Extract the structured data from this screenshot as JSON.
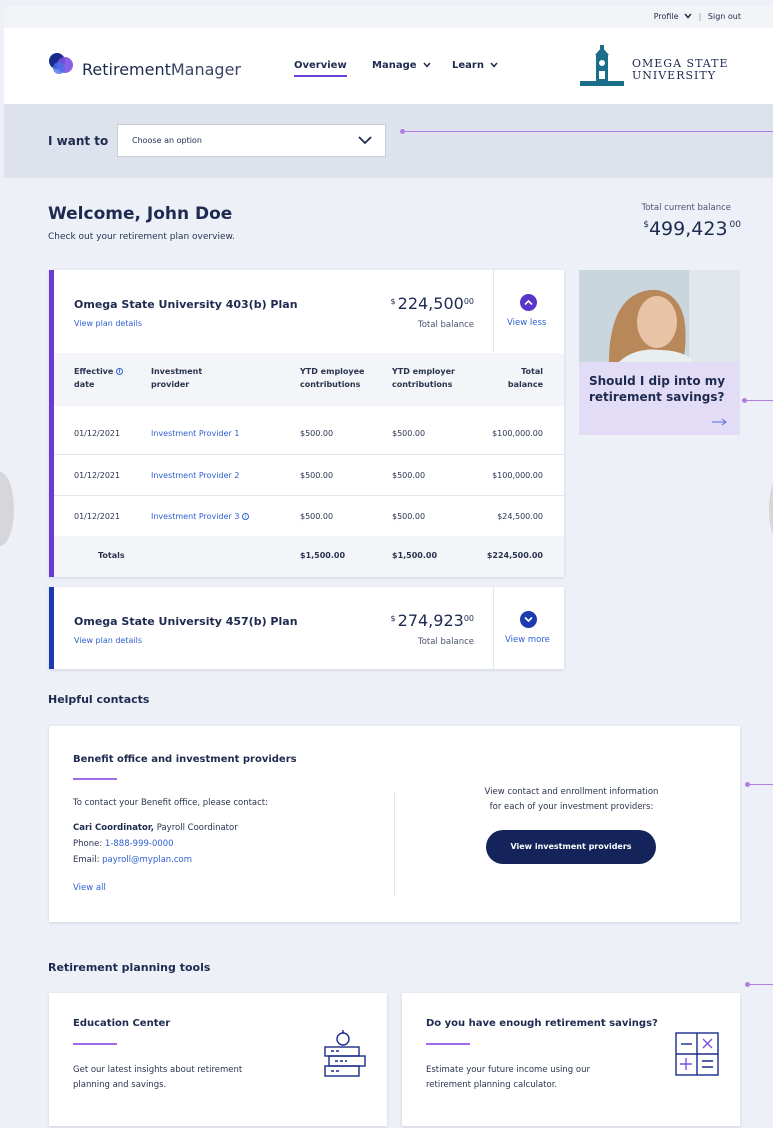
{
  "utility": {
    "profile": "Profile",
    "sign_out": "Sign out"
  },
  "header": {
    "brand_bold": "Retirement",
    "brand_light": "Manager",
    "nav": {
      "overview": "Overview",
      "manage": "Manage",
      "learn": "Learn"
    },
    "university": {
      "line1": "OMEGA STATE",
      "line2": "UNIVERSITY"
    }
  },
  "iwant": {
    "label": "I want to",
    "placeholder": "Choose an option"
  },
  "welcome": {
    "title": "Welcome, John Doe",
    "subtitle": "Check out your retirement plan overview.",
    "total_label": "Total current balance",
    "total_currency": "$",
    "total_whole": "499,423",
    "total_cents": "00"
  },
  "plans": [
    {
      "title": "Omega State University 403(b) Plan",
      "link": "View plan details",
      "currency": "$",
      "amount_whole": "224,500",
      "amount_cents": "00",
      "amount_label": "Total balance",
      "toggle_label": "View less",
      "headers": {
        "effective": [
          "Effective",
          "date"
        ],
        "provider": [
          "Investment",
          "provider"
        ],
        "ytd_employee": [
          "YTD employee",
          "contributions"
        ],
        "ytd_employer": [
          "YTD employer",
          "contributions"
        ],
        "total": [
          "Total",
          "balance"
        ]
      },
      "rows": [
        {
          "date": "01/12/2021",
          "provider": "Investment Provider 1",
          "employee": "$500.00",
          "employer": "$500.00",
          "total": "$100,000.00"
        },
        {
          "date": "01/12/2021",
          "provider": "Investment Provider 2",
          "employee": "$500.00",
          "employer": "$500.00",
          "total": "$100,000.00"
        },
        {
          "date": "01/12/2021",
          "provider": "Investment Provider 3",
          "employee": "$500.00",
          "employer": "$500.00",
          "total": "$24,500.00"
        }
      ],
      "totals": {
        "label": "Totals",
        "employee": "$1,500.00",
        "employer": "$1,500.00",
        "total": "$224,500.00"
      }
    },
    {
      "title": "Omega State University 457(b) Plan",
      "link": "View plan details",
      "currency": "$",
      "amount_whole": "274,923",
      "amount_cents": "00",
      "amount_label": "Total balance",
      "toggle_label": "View more"
    }
  ],
  "promo": {
    "line1": "Should I dip into my",
    "line2": "retirement savings?"
  },
  "contacts": {
    "section_title": "Helpful contacts",
    "card_title": "Benefit office and investment providers",
    "intro": "To contact your Benefit office, please contact:",
    "name": "Cari Coordinator,",
    "role": " Payroll Coordinator",
    "phone_label": "Phone: ",
    "phone": "1-888-999-0000",
    "email_label": "Email: ",
    "email": "payroll@myplan.com",
    "view_all": "View all",
    "right_line1": "View contact and enrollment information",
    "right_line2": "for each of your investment providers:",
    "button": "View investment providers"
  },
  "tools": {
    "section_title": "Retirement planning tools",
    "cards": [
      {
        "title": "Education Center",
        "line1": "Get our latest insights about retirement",
        "line2": "planning and savings."
      },
      {
        "title": "Do you have enough retirement savings?",
        "line1": "Estimate your future income using our",
        "line2": "retirement planning calculator."
      }
    ]
  },
  "colors": {
    "accent": "#6b3fd6",
    "navy": "#14245a",
    "link": "#2e5fd1",
    "connector": "#b07fe6"
  }
}
